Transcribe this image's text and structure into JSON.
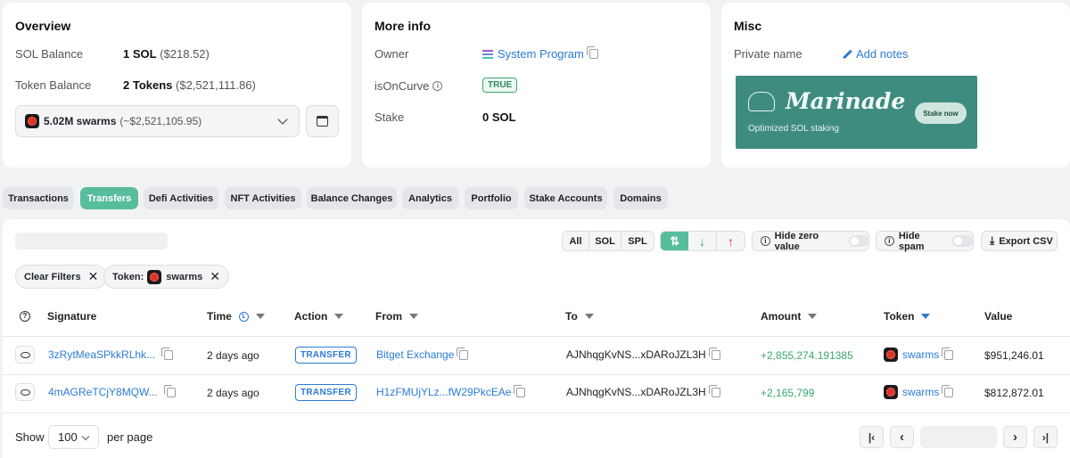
{
  "overview": {
    "title": "Overview",
    "sol_balance_label": "SOL Balance",
    "sol_balance_value": "1 SOL",
    "sol_balance_usd": "($218.52)",
    "token_balance_label": "Token Balance",
    "token_balance_value": "2 Tokens",
    "token_balance_usd": "($2,521,111.86)",
    "token_select_value": "5.02M swarms",
    "token_select_usd": "(~$2,521,105.95)"
  },
  "more_info": {
    "title": "More info",
    "owner_label": "Owner",
    "owner_value": "System Program",
    "isoncurve_label": "isOnCurve",
    "isoncurve_value": "TRUE",
    "stake_label": "Stake",
    "stake_value": "0 SOL"
  },
  "misc": {
    "title": "Misc",
    "private_name_label": "Private name",
    "add_notes_label": "Add notes",
    "banner": {
      "brand": "Marinade",
      "tagline": "Optimized SOL staking",
      "button": "Stake now",
      "bg_color": "#3e8c7f"
    }
  },
  "tabs": [
    "Transactions",
    "Transfers",
    "Defi Activities",
    "NFT Activities",
    "Balance Changes",
    "Analytics",
    "Portfolio",
    "Stake Accounts",
    "Domains"
  ],
  "active_tab": "Transfers",
  "toolbar": {
    "filter_all": "All",
    "filter_sol": "SOL",
    "filter_spl": "SPL",
    "hide_zero_label": "Hide zero value",
    "hide_spam_label": "Hide spam",
    "export_label": "Export CSV"
  },
  "chips": {
    "clear_filters": "Clear Filters",
    "token_prefix": "Token:",
    "token_name": "swarms"
  },
  "table": {
    "headers": {
      "signature": "Signature",
      "time": "Time",
      "action": "Action",
      "from": "From",
      "to": "To",
      "amount": "Amount",
      "token": "Token",
      "value": "Value"
    },
    "rows": [
      {
        "signature": "3zRytMeaSPkkRLhk...",
        "time": "2 days ago",
        "action": "TRANSFER",
        "from": "Bitget Exchange",
        "to": "AJNhqgKvNS...xDARoJZL3H",
        "amount": "+2,855,274.191385",
        "token": "swarms",
        "value": "$951,246.01"
      },
      {
        "signature": "4mAGReTCjY8MQW...",
        "time": "2 days ago",
        "action": "TRANSFER",
        "from": "H1zFMUjYLz...fW29PkcEAe",
        "to": "AJNhqgKvNS...xDARoJZL3H",
        "amount": "+2,165,799",
        "token": "swarms",
        "value": "$812,872.01"
      }
    ]
  },
  "pagination": {
    "show_label": "Show",
    "page_size": "100",
    "per_page_label": "per page"
  },
  "colors": {
    "accent_green": "#58bd9c",
    "link_blue": "#2b7bd6",
    "amount_green": "#3aa66f"
  }
}
